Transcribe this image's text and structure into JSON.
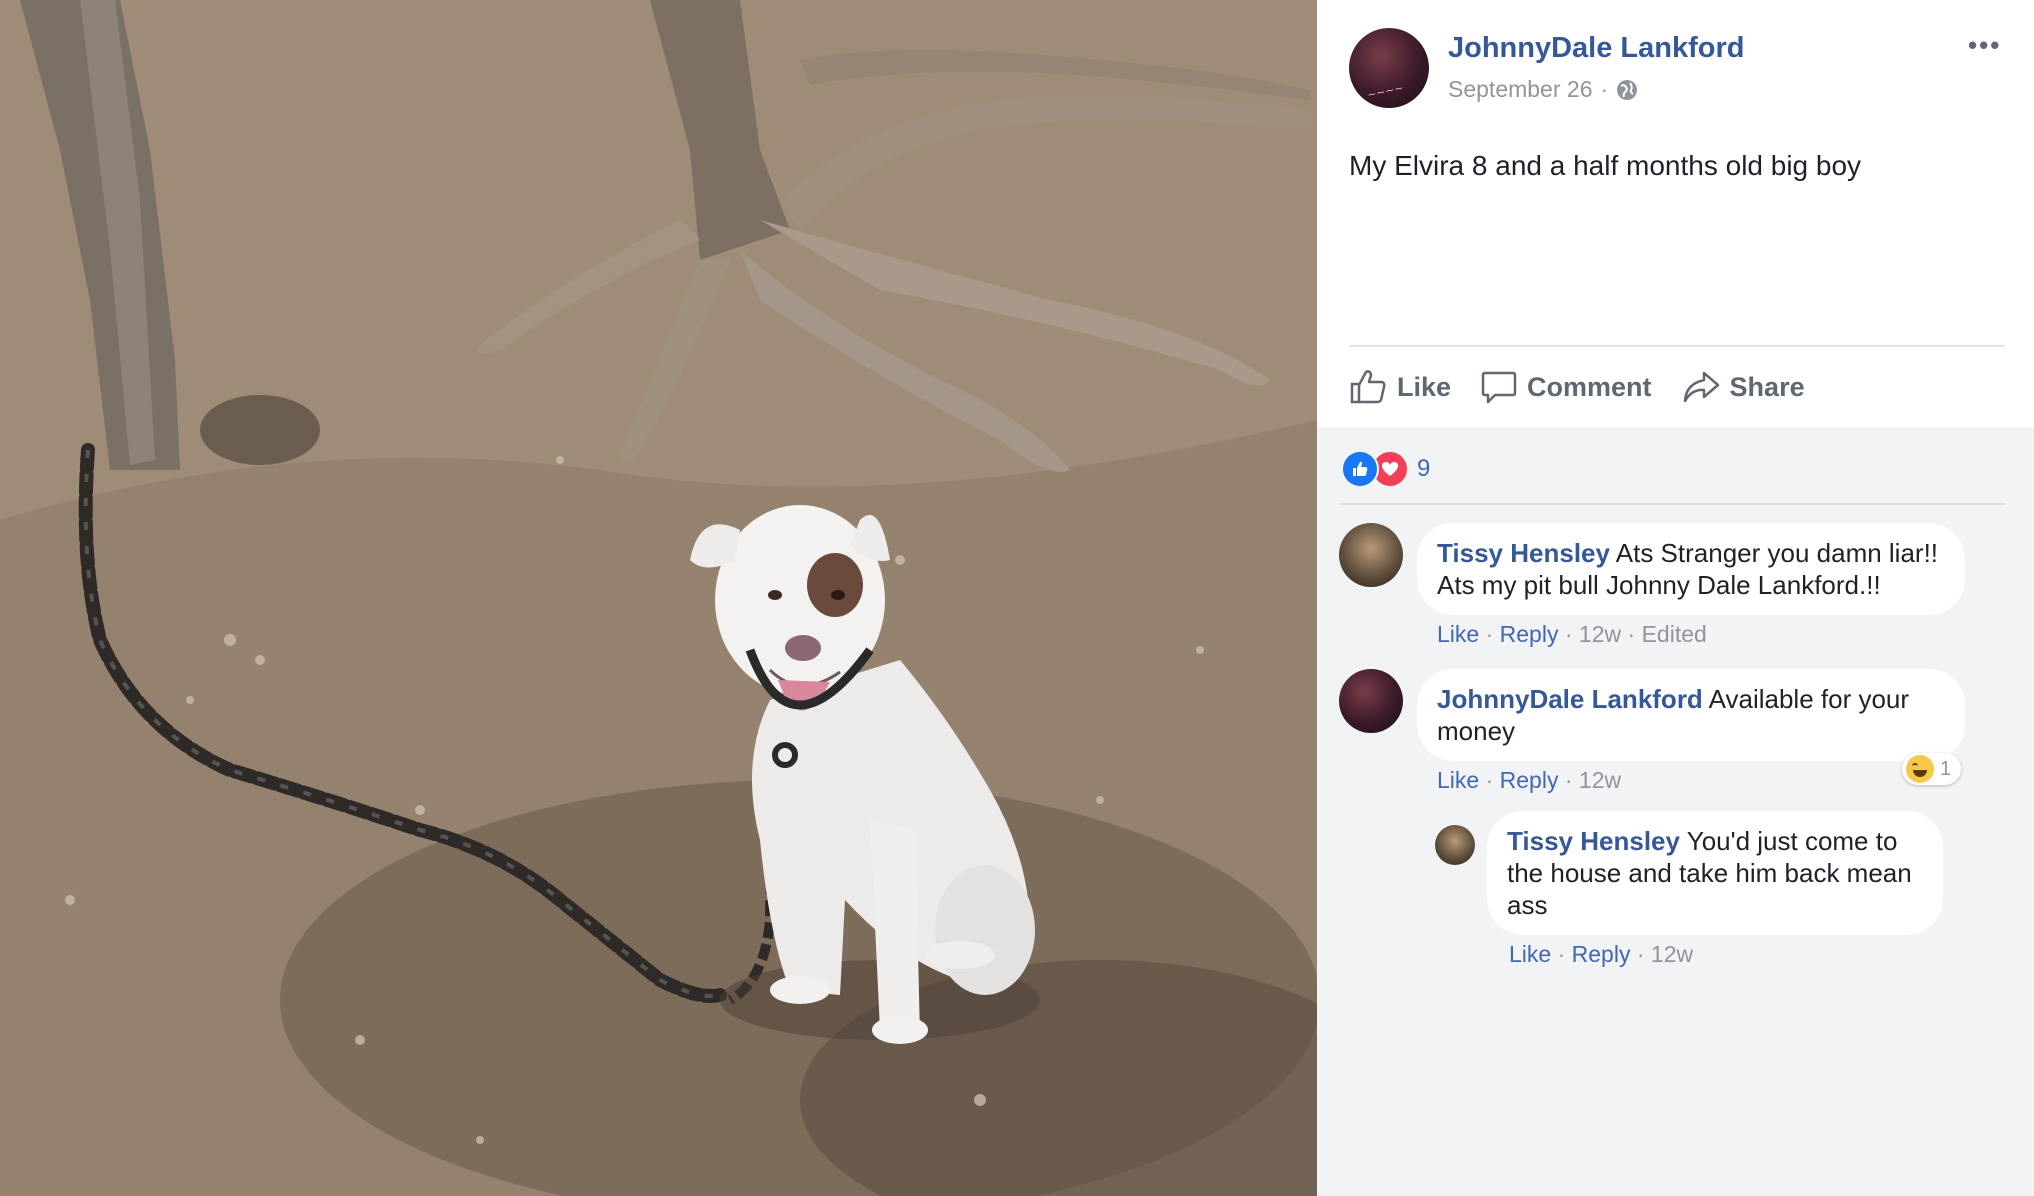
{
  "post": {
    "author": "JohnnyDale Lankford",
    "date": "September 26",
    "separator": "·",
    "caption": "My Elvira 8 and a half months old big boy",
    "more": "•••"
  },
  "actions": {
    "like": "Like",
    "comment": "Comment",
    "share": "Share"
  },
  "reactions": {
    "count": "9",
    "types": [
      "like-icon",
      "love-icon"
    ]
  },
  "comments": [
    {
      "name": "Tissy Hensley",
      "text": "Ats Stranger you damn liar!! Ats my pit bull Johnny Dale Lankford.!!",
      "like": "Like",
      "reply": "Reply",
      "time": "12w",
      "edited": "Edited"
    },
    {
      "name": "JohnnyDale Lankford",
      "text": "Available for your money",
      "like": "Like",
      "reply": "Reply",
      "time": "12w",
      "reaction_count": "1"
    },
    {
      "name": "Tissy Hensley",
      "text": "You'd just come to the house and take him back mean ass",
      "like": "Like",
      "reply": "Reply",
      "time": "12w"
    }
  ],
  "colors": {
    "link": "#365899",
    "meta": "#90949c",
    "panel": "#f2f3f5"
  }
}
